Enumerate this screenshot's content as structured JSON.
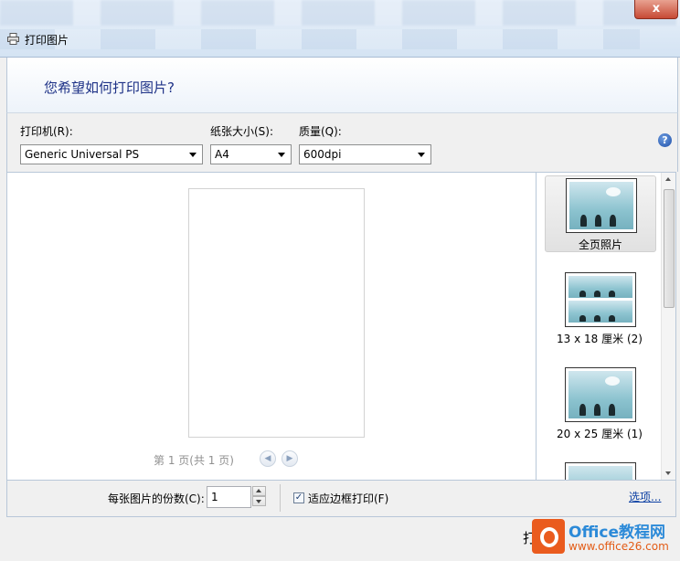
{
  "window": {
    "title": "打印图片",
    "close_label": "x"
  },
  "header": {
    "heading": "您希望如何打印图片?"
  },
  "form": {
    "printer_label": "打印机(R):",
    "printer_value": "Generic Universal PS",
    "paper_label": "纸张大小(S):",
    "paper_value": "A4",
    "quality_label": "质量(Q):",
    "quality_value": "600dpi",
    "help_label": "?"
  },
  "preview": {
    "page_info": "第 1 页(共 1 页)",
    "prev_label": "◀",
    "next_label": "▶"
  },
  "layouts": {
    "items": [
      {
        "label": "全页照片",
        "selected": true
      },
      {
        "label": "13 x 18 厘米 (2)",
        "selected": false
      },
      {
        "label": "20 x 25 厘米 (1)",
        "selected": false
      }
    ]
  },
  "bottom": {
    "copies_label": "每张图片的份数(C):",
    "copies_value": "1",
    "fit_label": "适应边框打印(F)",
    "fit_checked": "✓",
    "options_link": "选项..."
  },
  "footer": {
    "print_button_partial": "打",
    "watermark_name": "Office教程网",
    "watermark_url": "www.office26.com"
  }
}
